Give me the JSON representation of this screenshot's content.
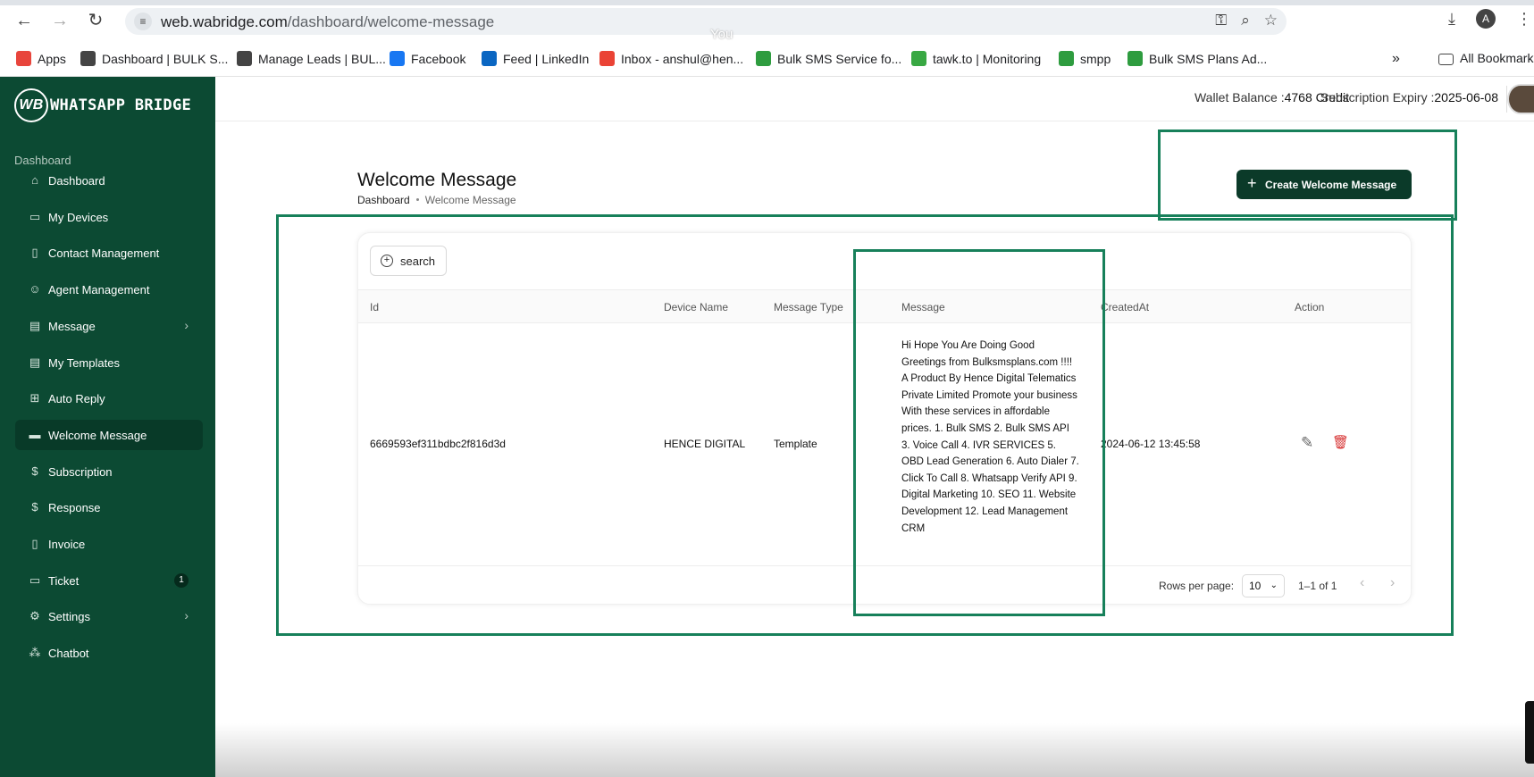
{
  "browser": {
    "url_host": "web.wabridge.com",
    "url_path": "/dashboard/welcome-message",
    "you_label": "You",
    "profile_initial": "A",
    "bookmarks": [
      {
        "label": "Apps",
        "icon": "apps-grid-icon",
        "color": "#e8453c"
      },
      {
        "label": "Dashboard | BULK S...",
        "icon": "globe-icon",
        "color": "#444444"
      },
      {
        "label": "Manage Leads | BUL...",
        "icon": "globe-icon",
        "color": "#444444"
      },
      {
        "label": "Facebook",
        "icon": "facebook-icon",
        "color": "#1877f2"
      },
      {
        "label": "Feed | LinkedIn",
        "icon": "linkedin-icon",
        "color": "#0a66c2"
      },
      {
        "label": "Inbox - anshul@hen...",
        "icon": "gmail-icon",
        "color": "#ea4335"
      },
      {
        "label": "Bulk SMS Service fo...",
        "icon": "bulksms-icon",
        "color": "#2e9c3f"
      },
      {
        "label": "tawk.to | Monitoring",
        "icon": "tawkto-icon",
        "color": "#38a843"
      },
      {
        "label": "smpp",
        "icon": "bulksms-icon",
        "color": "#2e9c3f"
      },
      {
        "label": "Bulk SMS Plans Ad...",
        "icon": "bulksms-icon",
        "color": "#2e9c3f"
      }
    ],
    "overflow": "»",
    "all_bookmarks": "All Bookmarks"
  },
  "app": {
    "logo_text": "WHATSAPP BRIDGE",
    "logo_mark": "WB",
    "sidebar_section": "Dashboard",
    "nav": [
      {
        "label": "Dashboard",
        "icon": "home-icon",
        "glyph": "⌂"
      },
      {
        "label": "My Devices",
        "icon": "devices-icon",
        "glyph": "▭"
      },
      {
        "label": "Contact Management",
        "icon": "contact-book-icon",
        "glyph": "▯"
      },
      {
        "label": "Agent Management",
        "icon": "users-icon",
        "glyph": "☺"
      },
      {
        "label": "Message",
        "icon": "message-icon",
        "glyph": "▤",
        "chevron": "›"
      },
      {
        "label": "My Templates",
        "icon": "template-icon",
        "glyph": "▤"
      },
      {
        "label": "Auto Reply",
        "icon": "grid-icon",
        "glyph": "⊞"
      },
      {
        "label": "Welcome Message",
        "icon": "welcome-message-icon",
        "glyph": "▬",
        "active": true
      },
      {
        "label": "Subscription",
        "icon": "dollar-circle-icon",
        "glyph": "$"
      },
      {
        "label": "Response",
        "icon": "dollar-circle-icon",
        "glyph": "$"
      },
      {
        "label": "Invoice",
        "icon": "pdf-icon",
        "glyph": "▯"
      },
      {
        "label": "Ticket",
        "icon": "ticket-icon",
        "glyph": "▭",
        "badge": "1"
      },
      {
        "label": "Settings",
        "icon": "gear-icon",
        "glyph": "⚙",
        "chevron": "›"
      },
      {
        "label": "Chatbot",
        "icon": "chatbot-icon",
        "glyph": "⁂"
      }
    ],
    "topbar": {
      "wallet_label": "Wallet Balance :",
      "wallet_value": "4768 Credit",
      "expiry_label": "Subscription Expiry :",
      "expiry_value": "2025-06-08"
    },
    "page": {
      "title": "Welcome Message",
      "breadcrumb_root": "Dashboard",
      "breadcrumb_current": "Welcome Message",
      "create_button": "Create Welcome Message",
      "search_button": "search"
    },
    "table": {
      "columns": [
        "Id",
        "Device Name",
        "Message Type",
        "Message",
        "CreatedAt",
        "Action"
      ],
      "rows": [
        {
          "id": "6669593ef311bdbc2f816d3d",
          "device_name": "HENCE DIGITAL",
          "message_type": "Template",
          "message": "Hi Hope You Are Doing Good Greetings from Bulksmsplans.com !!!! A Product By Hence Digital Telematics Private Limited Promote your business With these services in affordable prices. 1. Bulk SMS 2. Bulk SMS API 3. Voice Call 4. IVR SERVICES 5. OBD Lead Generation 6. Auto Dialer 7. Click To Call 8. Whatsapp Verify API 9. Digital Marketing 10. SEO 11. Website Development 12. Lead Management CRM",
          "created_at": "2024-06-12 13:45:58"
        }
      ],
      "rows_per_page_label": "Rows per page:",
      "rows_per_page": "10",
      "range": "1–1 of 1"
    },
    "colors": {
      "sidebar": "#0c4a33",
      "primary_button": "#0b3a29",
      "highlight": "#17805a",
      "delete": "#d62f2f"
    }
  }
}
